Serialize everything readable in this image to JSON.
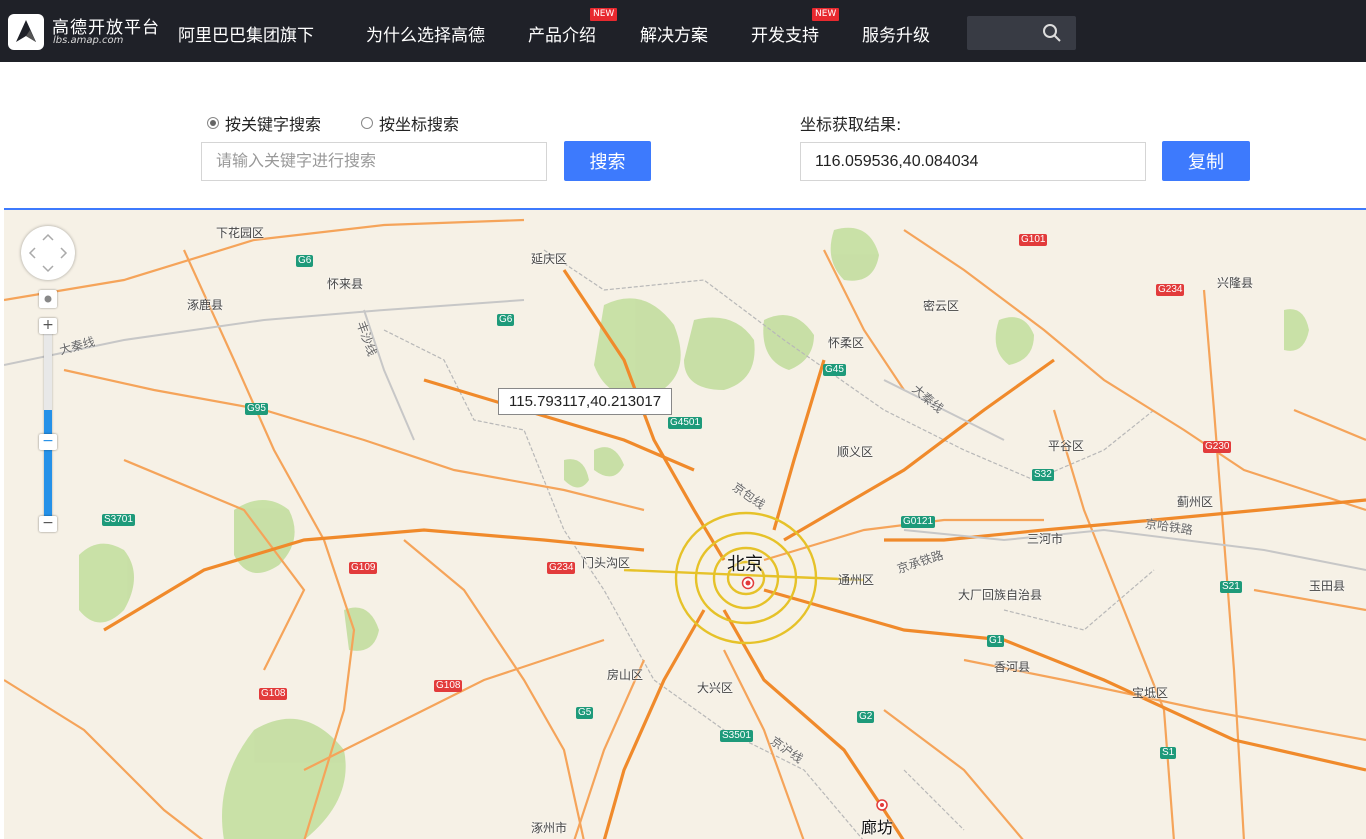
{
  "nav": {
    "logo_title": "高德开放平台",
    "logo_sub": "lbs.amap.com",
    "tagline": "阿里巴巴集团旗下",
    "items": [
      {
        "label": "为什么选择高德",
        "badge": ""
      },
      {
        "label": "产品介绍",
        "badge": "NEW"
      },
      {
        "label": "解决方案",
        "badge": ""
      },
      {
        "label": "开发支持",
        "badge": "NEW"
      },
      {
        "label": "服务升级",
        "badge": ""
      }
    ],
    "search_icon": "search-icon"
  },
  "search": {
    "radio_keyword": "按关键字搜索",
    "radio_coord": "按坐标搜索",
    "selected": "keyword",
    "keyword_placeholder": "请输入关键字进行搜索",
    "keyword_value": "",
    "search_button": "搜索",
    "result_label": "坐标获取结果:",
    "result_value": "116.059536,40.084034",
    "copy_button": "复制"
  },
  "map": {
    "tooltip": "115.793117,40.213017",
    "zoom_level_fraction": 0.4,
    "labels": {
      "beijing": "北京",
      "langfang": "廊坊",
      "xiahuayuan": "下花园区",
      "yanqing": "延庆区",
      "huailai": "怀来县",
      "zhuolu": "涿鹿县",
      "miyun": "密云区",
      "xinglong": "兴隆县",
      "huairou": "怀柔区",
      "shunyi": "顺义区",
      "pinggu": "平谷区",
      "jizhou": "蓟州区",
      "sanhe": "三河市",
      "mentougou": "门头沟区",
      "tongzhou": "通州区",
      "dachang": "大厂回族自治县",
      "yutian": "玉田县",
      "xianghe": "香河县",
      "fangshan": "房山区",
      "daxing": "大兴区",
      "baodi": "宝坻区",
      "zhuozhou": "涿州市"
    },
    "rails": {
      "daqin_w": "大秦线",
      "daqin_e": "大秦线",
      "fengsha": "丰沙线",
      "jingbao": "京包线",
      "jingha": "京哈铁路",
      "jingcheng": "京承铁路",
      "jinghu": "京沪线"
    },
    "shields": {
      "g6a": "G6",
      "g6b": "G6",
      "g95": "G95",
      "s3701": "S3701",
      "g109": "G109",
      "g234a": "G234",
      "g108a": "G108",
      "g108b": "G108",
      "g4501": "G4501",
      "g45": "G45",
      "g101": "G101",
      "g234b": "G234",
      "s32": "S32",
      "g230": "G230",
      "g0121": "G0121",
      "s21": "S21",
      "g1": "G1",
      "g5": "G5",
      "s3501": "S3501",
      "g2": "G2",
      "s1": "S1"
    }
  }
}
